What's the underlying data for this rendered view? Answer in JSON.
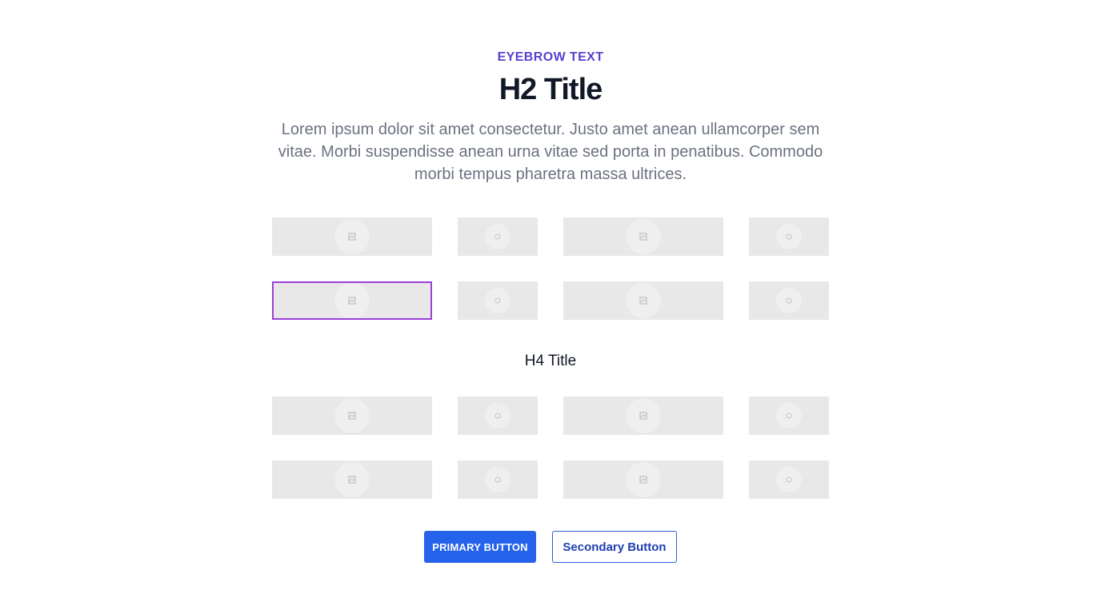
{
  "header": {
    "eyebrow": "EYEBROW TEXT",
    "title": "H2 Title",
    "description": "Lorem ipsum dolor sit amet consectetur. Justo amet anean ullamcorper sem vitae. Morbi suspendisse anean urna vitae sed porta in penatibus. Commodo morbi tempus pharetra massa ultrices."
  },
  "subsection": {
    "title": "H4 Title"
  },
  "buttons": {
    "primary_label": "PRIMARY BUTTON",
    "secondary_label": "Secondary Button"
  },
  "colors": {
    "eyebrow": "#5b3fd1",
    "primary_button": "#2563eb",
    "selected_outline": "#9b40d8",
    "placeholder_fill": "#e8e8e8"
  },
  "logo_placeholder_icon": "image-placeholder-icon"
}
